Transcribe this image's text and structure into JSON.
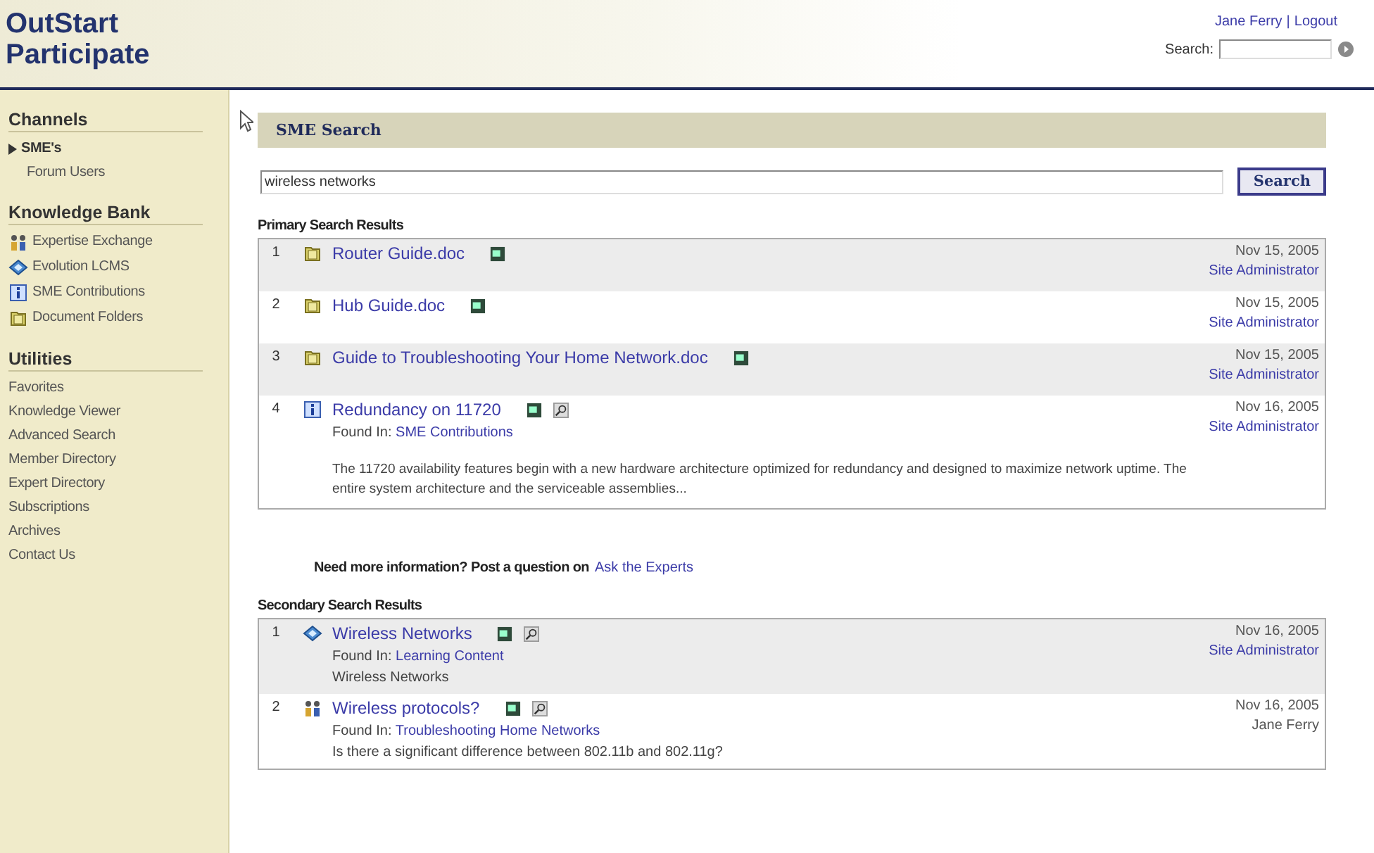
{
  "logo": {
    "line_1": "OutStart",
    "line_2": "Participate"
  },
  "header": {
    "user": "Jane Ferry",
    "separator": "|",
    "logout": "Logout",
    "search_label": "Search:"
  },
  "sidebar": {
    "sections": [
      {
        "title": "Channels",
        "kind": "channels",
        "items": [
          {
            "label": "SME's",
            "selected": true
          },
          {
            "label": "Forum Users",
            "selected": false
          }
        ]
      },
      {
        "title": "Knowledge Bank",
        "kind": "icons",
        "items": [
          {
            "label": "Expertise Exchange",
            "kind": "people"
          },
          {
            "label": "Evolution LCMS",
            "kind": "learning"
          },
          {
            "label": "SME Contributions",
            "kind": "info"
          },
          {
            "label": "Document Folders",
            "kind": "folder"
          }
        ]
      },
      {
        "title": "Utilities",
        "kind": "plain",
        "items": [
          {
            "label": "Favorites"
          },
          {
            "label": "Knowledge Viewer"
          },
          {
            "label": "Advanced Search"
          },
          {
            "label": "Member Directory"
          },
          {
            "label": "Expert Directory"
          },
          {
            "label": "Subscriptions"
          },
          {
            "label": "Archives"
          },
          {
            "label": "Contact Us"
          }
        ]
      }
    ]
  },
  "panel_title": "SME Search",
  "query": {
    "value": "wireless networks",
    "button": "Search"
  },
  "primary": {
    "heading": "Primary Search Results",
    "results": [
      {
        "number": "1",
        "kind": "folder",
        "title": "Router Guide.doc",
        "preview": false,
        "date": "Nov 15, 2005",
        "author": "Site Administrator",
        "author_link": true
      },
      {
        "number": "2",
        "kind": "folder",
        "title": "Hub Guide.doc",
        "preview": false,
        "date": "Nov 15, 2005",
        "author": "Site Administrator",
        "author_link": true
      },
      {
        "number": "3",
        "kind": "folder",
        "title": "Guide to Troubleshooting Your Home Network.doc",
        "preview": false,
        "date": "Nov 15, 2005",
        "author": "Site Administrator",
        "author_link": true
      },
      {
        "number": "4",
        "kind": "info",
        "title": "Redundancy on 11720",
        "preview": true,
        "found_label": "Found In:",
        "found_in": "SME Contributions",
        "description": "The 11720 availability features begin with a new hardware architecture optimized for redundancy and designed to maximize network uptime. The entire system architecture and the serviceable assemblies...",
        "date": "Nov 16, 2005",
        "author": "Site Administrator",
        "author_link": true
      }
    ]
  },
  "more_info": {
    "text": "Need more information?  Post a question on",
    "link": "Ask the Experts"
  },
  "secondary": {
    "heading": "Secondary Search Results",
    "results": [
      {
        "number": "1",
        "kind": "learning",
        "title": "Wireless Networks",
        "preview": true,
        "found_label": "Found In:",
        "found_in": "Learning Content",
        "snippet": "Wireless Networks",
        "date": "Nov 16, 2005",
        "author": "Site Administrator",
        "author_link": true
      },
      {
        "number": "2",
        "kind": "people",
        "title": "Wireless protocols?",
        "preview": true,
        "found_label": "Found In:",
        "found_in": "Troubleshooting Home Networks",
        "snippet": "Is there a significant difference between 802.11b and 802.11g?",
        "date": "Nov 16, 2005",
        "author": "Jane Ferry",
        "author_link": false
      }
    ]
  }
}
